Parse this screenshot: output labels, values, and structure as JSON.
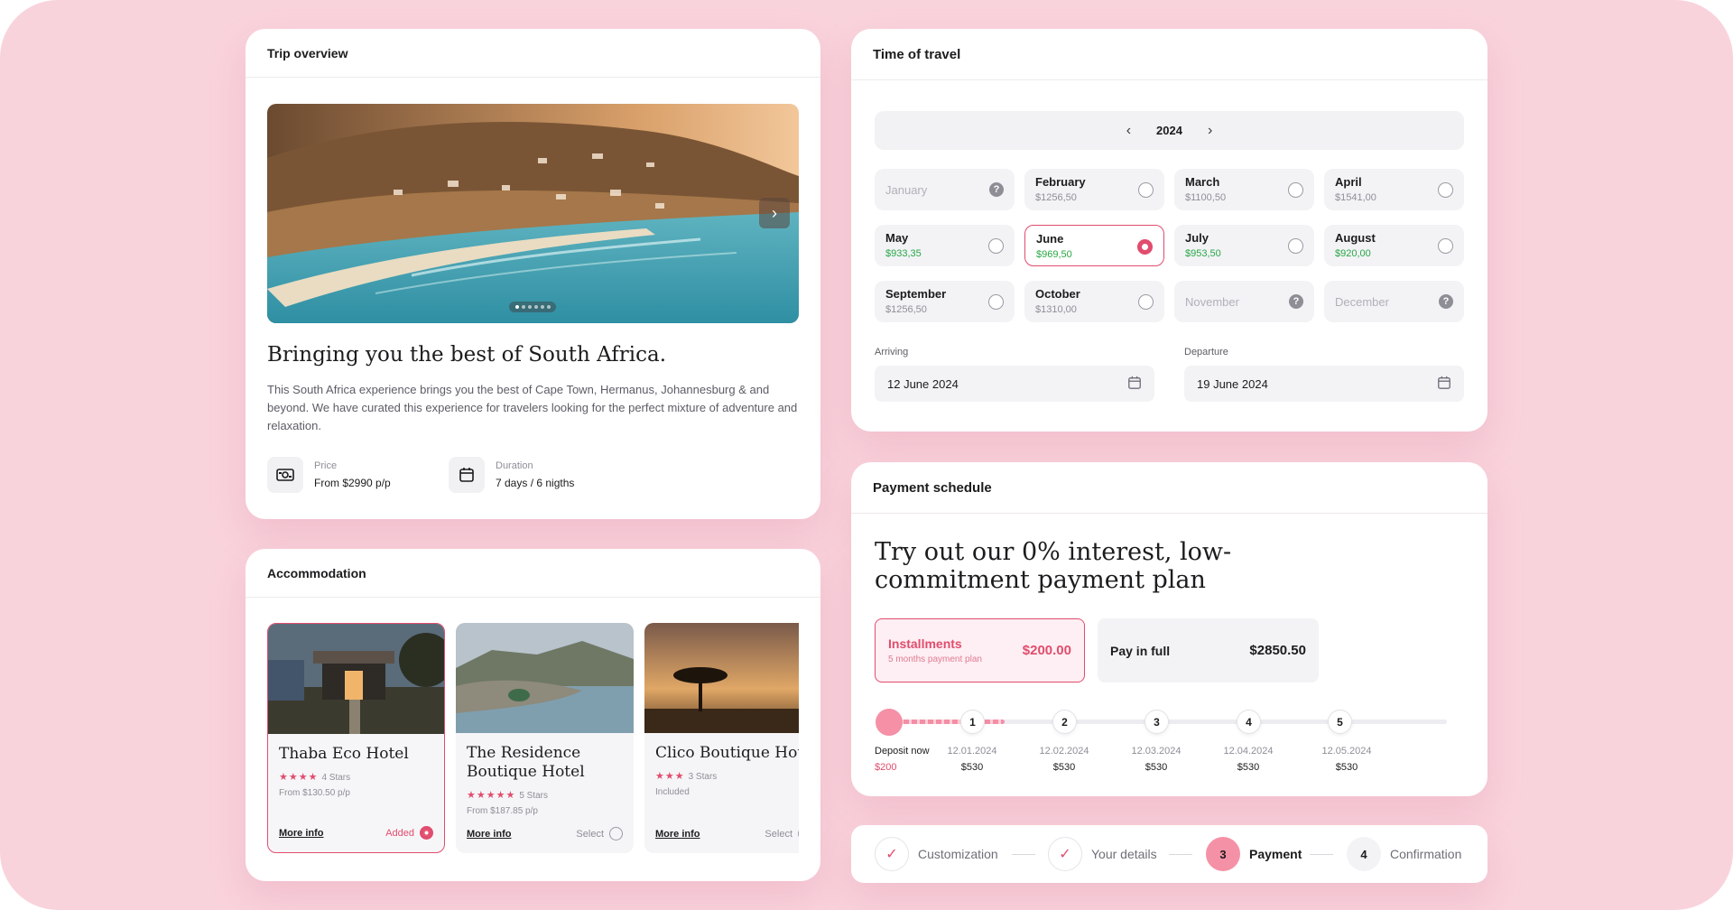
{
  "trip": {
    "header": "Trip overview",
    "title": "Bringing you the best of South Africa.",
    "description": "This South Africa experience brings you the best of Cape Town, Hermanus, Johannesburg & and beyond. We have curated this experience for travelers looking for the perfect mixture of adventure and relaxation.",
    "price_label": "Price",
    "price_value": "From $2990 p/p",
    "duration_label": "Duration",
    "duration_value": "7 days / 6 nigths",
    "carousel_current": 1,
    "carousel_total": 6
  },
  "accommodation": {
    "header": "Accommodation",
    "hotels": [
      {
        "name": "Thaba Eco Hotel",
        "stars": 4,
        "stars_label": "4 Stars",
        "price": "From $130.50 p/p",
        "more": "More info",
        "action": "Added",
        "selected": true
      },
      {
        "name": "The Residence Boutique Hotel",
        "stars": 5,
        "stars_label": "5 Stars",
        "price": "From $187.85 p/p",
        "more": "More info",
        "action": "Select",
        "selected": false
      },
      {
        "name": "Clico Boutique Hotel",
        "stars": 3,
        "stars_label": "3 Stars",
        "price": "Included",
        "more": "More info",
        "action": "Select",
        "selected": false
      }
    ]
  },
  "travel": {
    "header": "Time of travel",
    "year": "2024",
    "prev_icon": "chevron-left-icon",
    "next_icon": "chevron-right-icon",
    "months": [
      {
        "name": "January",
        "price": "",
        "state": "unavailable"
      },
      {
        "name": "February",
        "price": "$1256,50",
        "state": "available"
      },
      {
        "name": "March",
        "price": "$1100,50",
        "state": "available"
      },
      {
        "name": "April",
        "price": "$1541,00",
        "state": "available"
      },
      {
        "name": "May",
        "price": "$933,35",
        "state": "deal"
      },
      {
        "name": "June",
        "price": "$969,50",
        "state": "selected"
      },
      {
        "name": "July",
        "price": "$953,50",
        "state": "deal"
      },
      {
        "name": "August",
        "price": "$920,00",
        "state": "deal"
      },
      {
        "name": "September",
        "price": "$1256,50",
        "state": "available"
      },
      {
        "name": "October",
        "price": "$1310,00",
        "state": "available"
      },
      {
        "name": "November",
        "price": "",
        "state": "unavailable"
      },
      {
        "name": "December",
        "price": "",
        "state": "unavailable"
      }
    ],
    "arriving_label": "Arriving",
    "arriving_value": "12 June 2024",
    "departure_label": "Departure",
    "departure_value": "19 June 2024",
    "colors": {
      "accent": "#e14d6e",
      "deal": "#28a745"
    }
  },
  "payment": {
    "header": "Payment schedule",
    "title": "Try out our 0% interest, low-commitment payment plan",
    "installments_label": "Installments",
    "installments_sub": "5 months payment plan",
    "installments_amount": "$200.00",
    "full_label": "Pay in full",
    "full_amount": "$2850.50",
    "deposit_label": "Deposit now",
    "deposit_amount": "$200",
    "schedule": [
      {
        "step": "1",
        "date": "12.01.2024",
        "amount": "$530"
      },
      {
        "step": "2",
        "date": "12.02.2024",
        "amount": "$530"
      },
      {
        "step": "3",
        "date": "12.03.2024",
        "amount": "$530"
      },
      {
        "step": "4",
        "date": "12.04.2024",
        "amount": "$530"
      },
      {
        "step": "5",
        "date": "12.05.2024",
        "amount": "$530"
      }
    ]
  },
  "stepper": {
    "steps": [
      {
        "label": "Customization",
        "state": "done",
        "icon": "check-icon"
      },
      {
        "label": "Your details",
        "state": "done",
        "icon": "check-icon"
      },
      {
        "label": "Payment",
        "state": "current",
        "number": "3"
      },
      {
        "label": "Confirmation",
        "state": "upcoming",
        "number": "4"
      }
    ]
  }
}
